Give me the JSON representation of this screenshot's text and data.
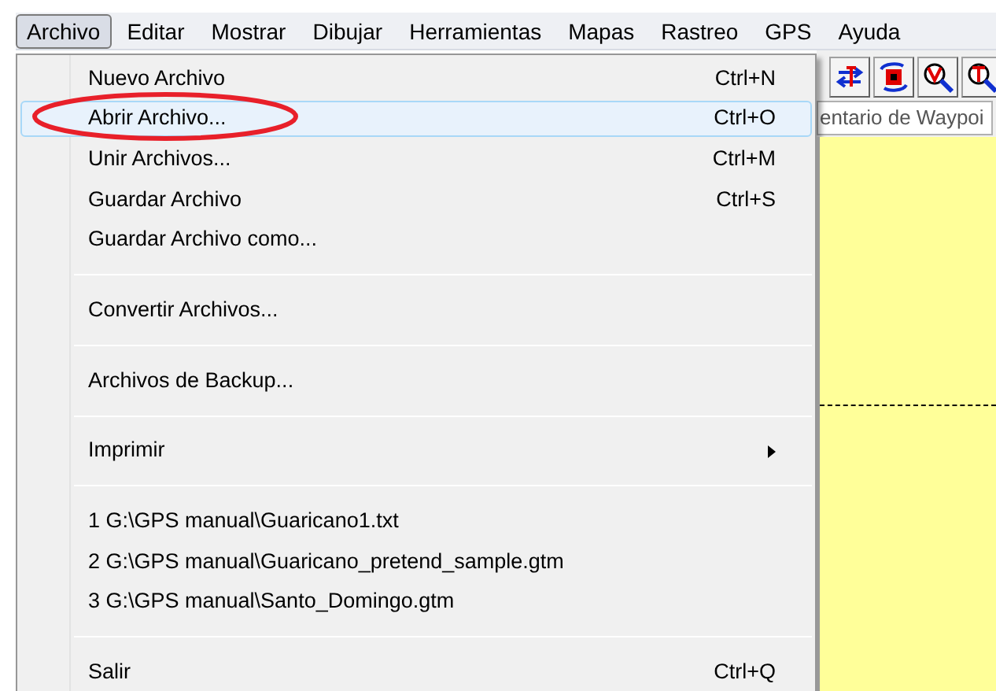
{
  "menu_bar": [
    {
      "label": "Archivo",
      "selected": true
    },
    {
      "label": "Editar",
      "selected": false
    },
    {
      "label": "Mostrar",
      "selected": false
    },
    {
      "label": "Dibujar",
      "selected": false
    },
    {
      "label": "Herramientas",
      "selected": false
    },
    {
      "label": "Mapas",
      "selected": false
    },
    {
      "label": "Rastreo",
      "selected": false
    },
    {
      "label": "GPS",
      "selected": false
    },
    {
      "label": "Ayuda",
      "selected": false
    }
  ],
  "file_menu": [
    {
      "kind": "item",
      "label": "Nuevo Archivo",
      "shortcut": "Ctrl+N",
      "selected": false
    },
    {
      "kind": "item",
      "label": "Abrir Archivo...",
      "shortcut": "Ctrl+O",
      "selected": true
    },
    {
      "kind": "item",
      "label": "Unir Archivos...",
      "shortcut": "Ctrl+M",
      "selected": false
    },
    {
      "kind": "item",
      "label": "Guardar Archivo",
      "shortcut": "Ctrl+S",
      "selected": false
    },
    {
      "kind": "item",
      "label": "Guardar Archivo como...",
      "selected": false
    },
    {
      "kind": "separator"
    },
    {
      "kind": "item",
      "label": "Convertir Archivos...",
      "selected": false
    },
    {
      "kind": "separator"
    },
    {
      "kind": "item",
      "label": "Archivos de Backup...",
      "selected": false
    },
    {
      "kind": "separator"
    },
    {
      "kind": "submenu",
      "label": "Imprimir",
      "selected": false
    },
    {
      "kind": "separator"
    },
    {
      "kind": "item",
      "label": "1 G:\\GPS manual\\Guaricano1.txt",
      "selected": false
    },
    {
      "kind": "item",
      "label": "2 G:\\GPS manual\\Guaricano_pretend_sample.gtm",
      "selected": false
    },
    {
      "kind": "item",
      "label": "3 G:\\GPS manual\\Santo_Domingo.gtm",
      "selected": false
    },
    {
      "kind": "separator"
    },
    {
      "kind": "item",
      "label": "Salir",
      "shortcut": "Ctrl+Q",
      "selected": false
    }
  ],
  "waypoint_field": {
    "value": "entario de Waypoi"
  }
}
